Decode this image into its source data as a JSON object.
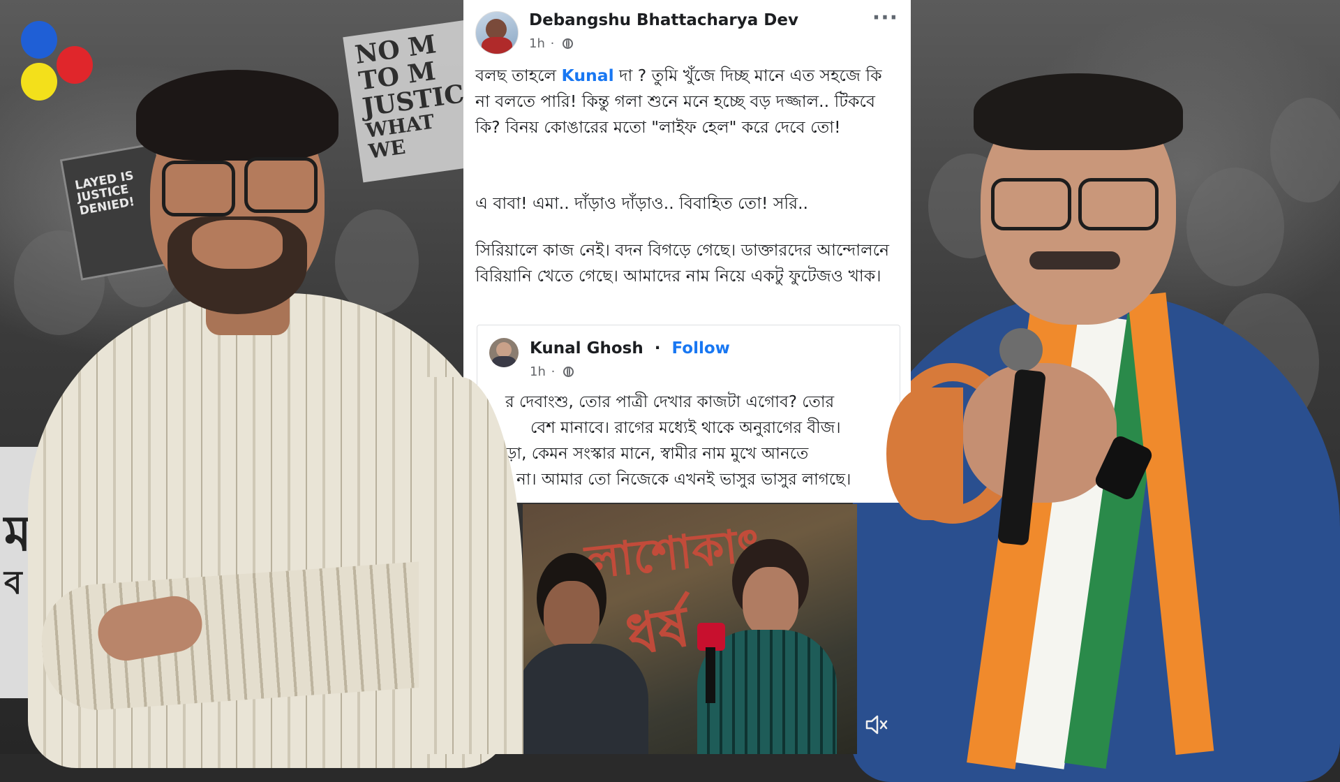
{
  "post": {
    "author": "Debangshu Bhattacharya Dev",
    "time": "1h",
    "more_label": "···",
    "mention": "Kunal",
    "para1_a": "বলছ তাহলে ",
    "para1_b": " দা ? তুমি খুঁজে দিচ্ছ মানে এত সহজে কি না বলতে পারি! কিন্তু গলা শুনে মনে হচ্ছে বড় দজ্জাল.. টিকবে কি? বিনয় কোঙারের মতো \"লাইফ হেল\" করে দেবে তো!",
    "para2": "এ বাবা! এমা.. দাঁড়াও দাঁড়াও.. বিবাহিত তো! সরি..",
    "para3": "সিরিয়ালে কাজ নেই। বদন বিগড়ে গেছে। ডাক্তারদের আন্দোলনে বিরিয়ানি খেতে গেছে। আমাদের নাম নিয়ে একটু ফুটেজও খাক।"
  },
  "shared_post": {
    "author": "Kunal Ghosh",
    "separator": "·",
    "follow_label": "Follow",
    "time": "1h",
    "line1": "র দেবাংশু, তোর পাত্রী দেখার কাজটা এগোব? তোর",
    "line2": "বেশ মানাবে। রাগের মধ্যেই থাকে অনুরাগের বীজ।",
    "line3": "ড়া, কেমন সংস্কার মানে, স্বামীর নাম মুখে আনতে",
    "line4": "না। আমার তো নিজেকে এখনই ভাসুর ভাসুর লাগছে।"
  },
  "background": {
    "sign_no": "NO M",
    "sign_to": "TO M",
    "sign_justice": "JUSTIC",
    "sign_what": "WHAT WE",
    "sign_delayed": "LAYED IS\nJUSTICE\nDENIED!",
    "banner_char": "ম",
    "banner_char2": "ব"
  },
  "video": {
    "graffiti1": "লাশোকাৎ",
    "graffiti2": "ধর্ষ"
  },
  "icons": {
    "logo": "logo-icon",
    "globe": "globe-icon",
    "mute": "speaker-muted-icon"
  },
  "colors": {
    "link": "#1877f2",
    "logo_blue": "#1f5fd6",
    "logo_red": "#e0262b",
    "logo_yellow": "#f3e01b"
  }
}
